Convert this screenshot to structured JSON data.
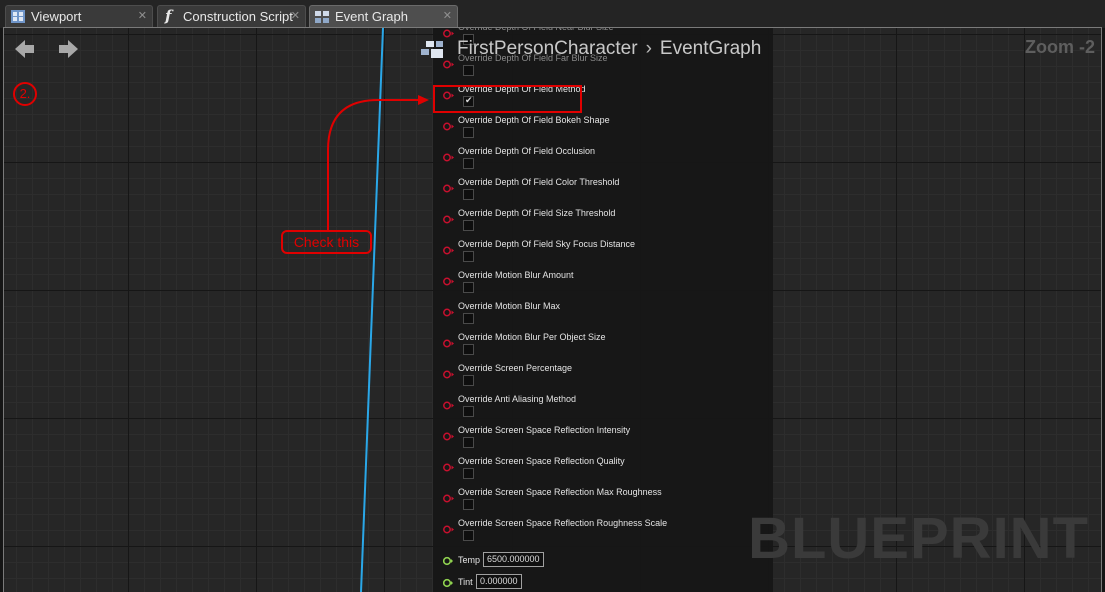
{
  "tabs": [
    {
      "label": "Viewport",
      "icon": "viewport-icon",
      "close": "✕",
      "active": false
    },
    {
      "label": "Construction Script",
      "icon": "function-icon",
      "close": "✕",
      "active": false
    },
    {
      "label": "Event Graph",
      "icon": "event-graph-icon",
      "close": "✕",
      "active": true
    }
  ],
  "breadcrumb": {
    "blueprint": "FirstPersonCharacter",
    "separator": "›",
    "graph": "EventGraph"
  },
  "zoom": "Zoom -2",
  "annotation": {
    "step": "2.",
    "callout": "Check this",
    "color": "#e00000"
  },
  "node": {
    "pins": [
      {
        "label": "Override Depth Of Field Near Blur Size",
        "checked": false
      },
      {
        "label": "Override Depth Of Field Far Blur Size",
        "checked": false
      },
      {
        "label": "Override Depth Of Field Method",
        "checked": true
      },
      {
        "label": "Override Depth Of Field Bokeh Shape",
        "checked": false
      },
      {
        "label": "Override Depth Of Field Occlusion",
        "checked": false
      },
      {
        "label": "Override Depth Of Field Color Threshold",
        "checked": false
      },
      {
        "label": "Override Depth Of Field Size Threshold",
        "checked": false
      },
      {
        "label": "Override Depth Of Field Sky Focus Distance",
        "checked": false
      },
      {
        "label": "Override Motion Blur Amount",
        "checked": false
      },
      {
        "label": "Override Motion Blur Max",
        "checked": false
      },
      {
        "label": "Override Motion Blur Per Object Size",
        "checked": false
      },
      {
        "label": "Override Screen Percentage",
        "checked": false
      },
      {
        "label": "Override Anti Aliasing Method",
        "checked": false
      },
      {
        "label": "Override Screen Space Reflection Intensity",
        "checked": false
      },
      {
        "label": "Override Screen Space Reflection Quality",
        "checked": false
      },
      {
        "label": "Override Screen Space Reflection Max Roughness",
        "checked": false
      },
      {
        "label": "Override Screen Space Reflection Roughness Scale",
        "checked": false
      }
    ],
    "values": [
      {
        "label": "Temp",
        "value": "6500.000000"
      },
      {
        "label": "Tint",
        "value": "0.000000"
      }
    ],
    "bool_pin_color": "#c8102e",
    "float_pin_color": "#8fd14f"
  },
  "wire_color": "#2aa7e8",
  "watermark": "BLUEPRINT"
}
